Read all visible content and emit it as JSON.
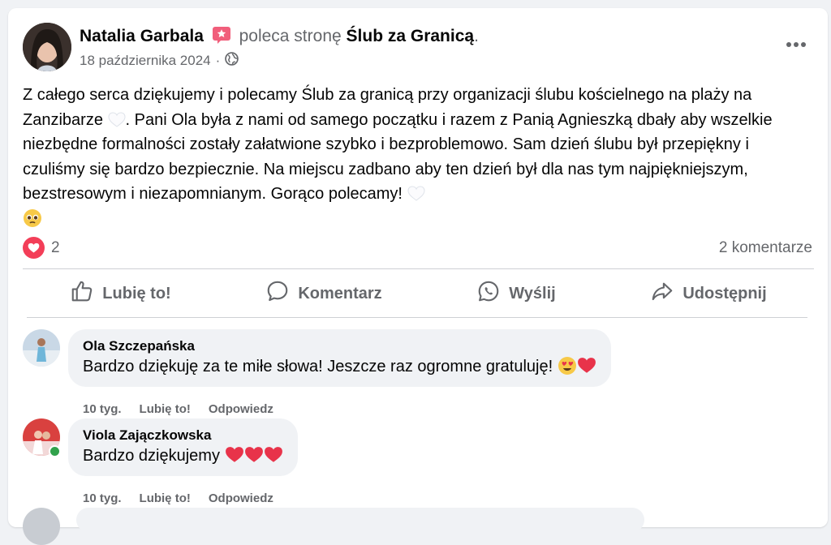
{
  "post": {
    "author": "Natalia Garbala",
    "recommends_text": "poleca stronę",
    "page_name": "Ślub za Granicą",
    "period": ".",
    "date": "18 października 2024",
    "separator": "·",
    "text_part1": "Z całego serca dziękujemy i polecamy Ślub za granicą przy organizacji ślubu kościelnego na plaży na Zanzibarze",
    "text_part2": ". Pani Ola była z nami od samego początku i razem z Panią Agnieszką dbały aby wszelkie niezbędne formalności zostały załatwione szybko i bezproblemowo. Sam dzień ślubu był przepiękny i czuliśmy się bardzo bezpiecznie. Na miejscu zadbano aby ten dzień był dla nas tym najpiękniejszym, bezstresowym i niezapomnianym. Gorąco polecamy!",
    "reaction_count": "2",
    "comments_count": "2 komentarze"
  },
  "actions": {
    "like": "Lubię to!",
    "comment": "Komentarz",
    "send": "Wyślij",
    "share": "Udostępnij"
  },
  "comments": [
    {
      "name": "Ola Szczepańska",
      "text": "Bardzo dziękuję za te miłe słowa! Jeszcze raz ogromne gratuluję!",
      "time": "10 tyg.",
      "like": "Lubię to!",
      "reply": "Odpowiedz"
    },
    {
      "name": "Viola Zajączkowska",
      "text": "Bardzo dziękujemy",
      "time": "10 tyg.",
      "like": "Lubię to!",
      "reply": "Odpowiedz"
    }
  ],
  "colors": {
    "accent_heart": "#f33e58",
    "text_secondary": "#65676b",
    "bubble_bg": "#f0f2f5",
    "online": "#31a24c"
  },
  "icons": {
    "more": "more-horizontal-icon",
    "privacy": "globe-icon",
    "recommend": "recommend-badge-icon"
  }
}
